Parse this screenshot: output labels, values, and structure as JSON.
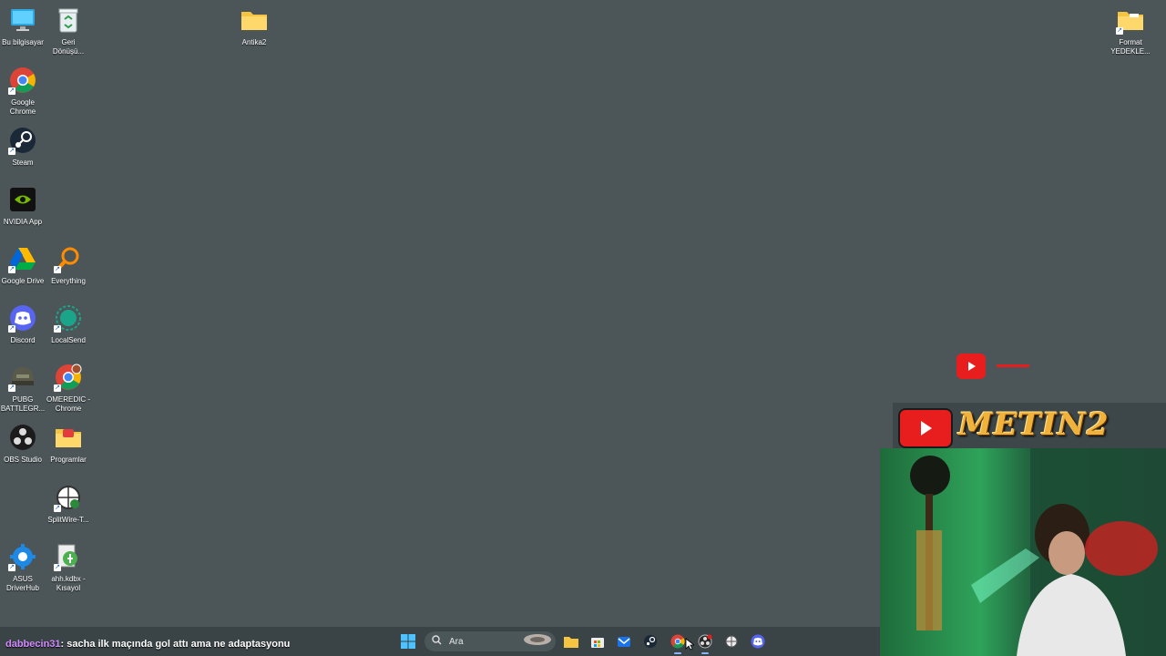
{
  "desktop": {
    "icons": [
      {
        "name": "this-pc",
        "label": "Bu bilgisayar"
      },
      {
        "name": "recycle-bin",
        "label": "Geri\nDönüşü..."
      },
      {
        "name": "antika2-folder",
        "label": "Antika2"
      },
      {
        "name": "format-yedekler-folder",
        "label": "Format\nYEDEKLE..."
      },
      {
        "name": "google-chrome",
        "label": "Google\nChrome"
      },
      {
        "name": "steam",
        "label": "Steam"
      },
      {
        "name": "nvidia-app",
        "label": "NVIDIA App"
      },
      {
        "name": "google-drive",
        "label": "Google Drive"
      },
      {
        "name": "everything",
        "label": "Everything"
      },
      {
        "name": "discord",
        "label": "Discord"
      },
      {
        "name": "localsend",
        "label": "LocalSend"
      },
      {
        "name": "pubg",
        "label": "PUBG\nBATTLEGR..."
      },
      {
        "name": "omeredic-chrome",
        "label": "OMEREDIC -\nChrome"
      },
      {
        "name": "obs-studio",
        "label": "OBS Studio"
      },
      {
        "name": "programlar-folder",
        "label": "Programlar"
      },
      {
        "name": "splitwire",
        "label": "SplitWire-T..."
      },
      {
        "name": "asus-driverhub",
        "label": "ASUS\nDriverHub"
      },
      {
        "name": "keepass-shortcut",
        "label": "ahh.kdbx -\nKısayol"
      }
    ]
  },
  "overlay": {
    "logo_text": "METIN2"
  },
  "chat": {
    "user": "dabbecin31",
    "message": ": sacha ilk maçında gol attı ama ne adaptasyonu"
  },
  "taskbar": {
    "search_placeholder": "Ara"
  },
  "colors": {
    "desktop_bg": "#4c5659",
    "taskbar_bg": "#3a4346",
    "youtube_red": "#e81d1d",
    "metin_gold": "#f0b23a",
    "chat_user": "#d38cff"
  }
}
